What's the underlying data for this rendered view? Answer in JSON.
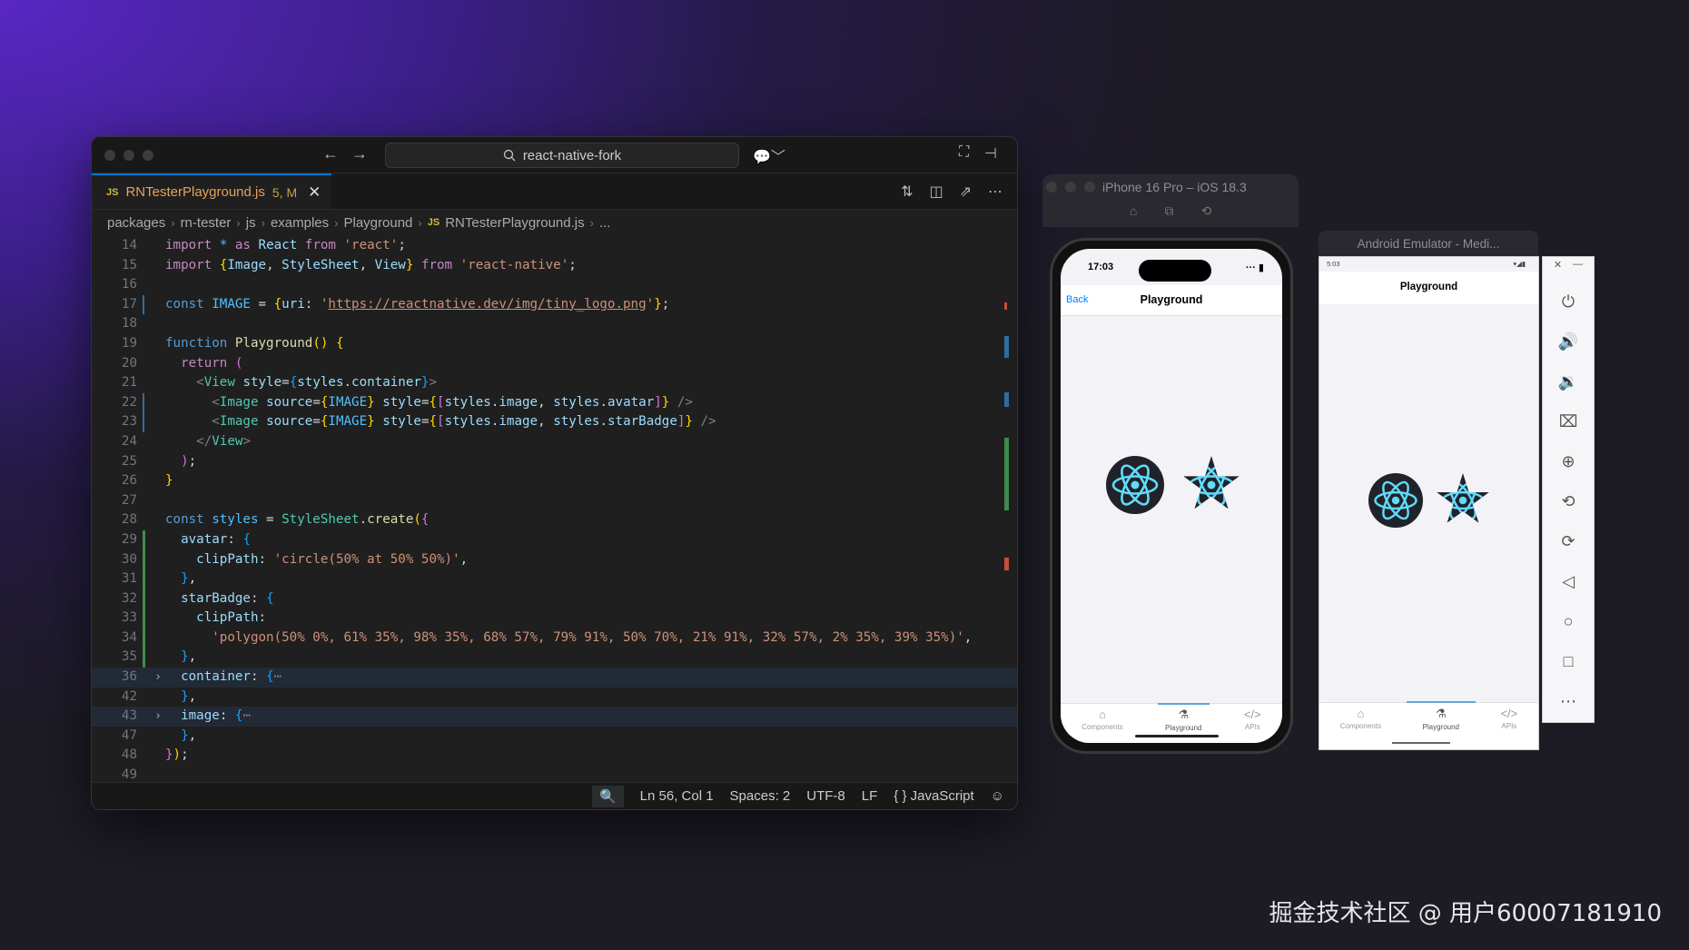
{
  "vscode": {
    "search": "react-native-fork",
    "tab": {
      "lang": "JS",
      "name": "RNTesterPlayground.js",
      "badge": "5, M"
    },
    "breadcrumb": [
      "packages",
      "rn-tester",
      "js",
      "examples",
      "Playground",
      "RNTesterPlayground.js",
      "..."
    ],
    "lines": [
      {
        "n": "14",
        "g": "",
        "f": "",
        "h": "<span class=\"kw\">import</span> <span class=\"co\">*</span> <span class=\"kw\">as</span> <span class=\"va\">React</span> <span class=\"kw\">from</span> <span class=\"st\">'react'</span>;"
      },
      {
        "n": "15",
        "g": "",
        "f": "",
        "h": "<span class=\"kw\">import</span> <span class=\"br1\">{</span><span class=\"va\">Image</span>, <span class=\"va\">StyleSheet</span>, <span class=\"va\">View</span><span class=\"br1\">}</span> <span class=\"kw\">from</span> <span class=\"st\">'react-native'</span>;"
      },
      {
        "n": "16",
        "g": "",
        "f": "",
        "h": ""
      },
      {
        "n": "17",
        "g": "mod",
        "f": "",
        "h": "<span class=\"kb\">const</span> <span class=\"co\">IMAGE</span> = <span class=\"br1\">{</span><span class=\"va\">uri</span>: <span class=\"st\">'<span class=\"url\">https://reactnative.dev/img/tiny_logo.png</span>'</span><span class=\"br1\">}</span>;"
      },
      {
        "n": "18",
        "g": "",
        "f": "",
        "h": ""
      },
      {
        "n": "19",
        "g": "",
        "f": "",
        "h": "<span class=\"kb\">function</span> <span class=\"fn\">Playground</span><span class=\"br1\">()</span> <span class=\"br1\">{</span>"
      },
      {
        "n": "20",
        "g": "",
        "f": "",
        "h": "  <span class=\"kw\">return</span> <span class=\"br2\">(</span>"
      },
      {
        "n": "21",
        "g": "",
        "f": "",
        "h": "    <span class=\"tg\">&lt;</span><span class=\"ty\">View</span> <span class=\"va\">style</span>=<span class=\"br3\">{</span><span class=\"va\">styles</span>.<span class=\"va\">container</span><span class=\"br3\">}</span><span class=\"tg\">&gt;</span>"
      },
      {
        "n": "22",
        "g": "mod",
        "f": "",
        "h": "      <span class=\"tg\">&lt;</span><span class=\"ty\">Image</span> <span class=\"va\">source</span>=<span class=\"br1\">{</span><span class=\"co\">IMAGE</span><span class=\"br1\">}</span> <span class=\"va\">style</span>=<span class=\"br1\">{</span><span class=\"br2\">[</span><span class=\"va\">styles</span>.<span class=\"va\">image</span>, <span class=\"va\">styles</span>.<span class=\"va\">avatar</span><span class=\"br2\">]</span><span class=\"br1\">}</span> <span class=\"tg\">/&gt;</span>"
      },
      {
        "n": "23",
        "g": "mod",
        "f": "",
        "h": "      <span class=\"tg\">&lt;</span><span class=\"ty\">Image</span> <span class=\"va\">source</span>=<span class=\"br1\">{</span><span class=\"co\">IMAGE</span><span class=\"br1\">}</span> <span class=\"va\">style</span>=<span class=\"br1\">{</span><span class=\"br2\">[</span><span class=\"va\">styles</span>.<span class=\"va\">image</span>, <span class=\"va\">styles</span>.<span class=\"va\">starBadge</span><span class=\"br2\">]</span><span class=\"br1\">}</span> <span class=\"tg\">/&gt;</span>"
      },
      {
        "n": "24",
        "g": "",
        "f": "",
        "h": "    <span class=\"tg\">&lt;/</span><span class=\"ty\">View</span><span class=\"tg\">&gt;</span>"
      },
      {
        "n": "25",
        "g": "",
        "f": "",
        "h": "  <span class=\"br2\">)</span>;"
      },
      {
        "n": "26",
        "g": "",
        "f": "",
        "h": "<span class=\"br1\">}</span>"
      },
      {
        "n": "27",
        "g": "",
        "f": "",
        "h": ""
      },
      {
        "n": "28",
        "g": "",
        "f": "",
        "h": "<span class=\"kb\">const</span> <span class=\"co\">styles</span> = <span class=\"ty\">StyleSheet</span>.<span class=\"fn\">create</span><span class=\"br1\">(</span><span class=\"br2\">{</span>"
      },
      {
        "n": "29",
        "g": "add",
        "f": "",
        "h": "  <span class=\"va\">avatar</span>: <span class=\"br3\">{</span>"
      },
      {
        "n": "30",
        "g": "add",
        "f": "",
        "h": "    <span class=\"va\">clipPath</span>: <span class=\"st\">'circle(50% at 50% 50%)'</span>,"
      },
      {
        "n": "31",
        "g": "add",
        "f": "",
        "h": "  <span class=\"br3\">}</span>,"
      },
      {
        "n": "32",
        "g": "add",
        "f": "",
        "h": "  <span class=\"va\">starBadge</span>: <span class=\"br3\">{</span>"
      },
      {
        "n": "33",
        "g": "add",
        "f": "",
        "h": "    <span class=\"va\">clipPath</span>:"
      },
      {
        "n": "34",
        "g": "add",
        "f": "",
        "h": "      <span class=\"st\">'polygon(50% 0%, 61% 35%, 98% 35%, 68% 57%, 79% 91%, 50% 70%, 21% 91%, 32% 57%, 2% 35%, 39% 35%)'</span>,"
      },
      {
        "n": "35",
        "g": "add",
        "f": "",
        "h": "  <span class=\"br3\">}</span>,"
      },
      {
        "n": "36",
        "g": "",
        "f": "›",
        "hl": true,
        "h": "  <span class=\"va\">container</span>: <span class=\"br3\">{</span><span class=\"tg\">⋯</span>"
      },
      {
        "n": "42",
        "g": "",
        "f": "",
        "h": "  <span class=\"br3\">}</span>,"
      },
      {
        "n": "43",
        "g": "",
        "f": "›",
        "hl": true,
        "h": "  <span class=\"va\">image</span>: <span class=\"br3\">{</span><span class=\"tg\">⋯</span>"
      },
      {
        "n": "47",
        "g": "",
        "f": "",
        "h": "  <span class=\"br3\">}</span>,"
      },
      {
        "n": "48",
        "g": "",
        "f": "",
        "h": "<span class=\"br2\">}</span><span class=\"br1\">)</span>;"
      },
      {
        "n": "49",
        "g": "",
        "f": "",
        "h": ""
      }
    ],
    "status": {
      "position": "Ln 56, Col 1",
      "spaces": "Spaces: 2",
      "encoding": "UTF-8",
      "eol": "LF",
      "language": "JavaScript",
      "lang_icon": "{ }"
    }
  },
  "ios": {
    "window_title": "iPhone 16 Pro – iOS 18.3",
    "time": "17:03",
    "back": "Back",
    "title": "Playground",
    "tabs": [
      "Components",
      "Playground",
      "APIs"
    ]
  },
  "android": {
    "window_title": "Android Emulator - Medi...",
    "time": "5:03",
    "title": "Playground",
    "tabs": [
      "Components",
      "Playground",
      "APIs"
    ]
  },
  "colors": {
    "accent": "#0078d4",
    "react_cyan": "#61dafb",
    "logo_bg": "#20232a"
  },
  "watermark": "掘金技术社区 @ 用户60007181910"
}
